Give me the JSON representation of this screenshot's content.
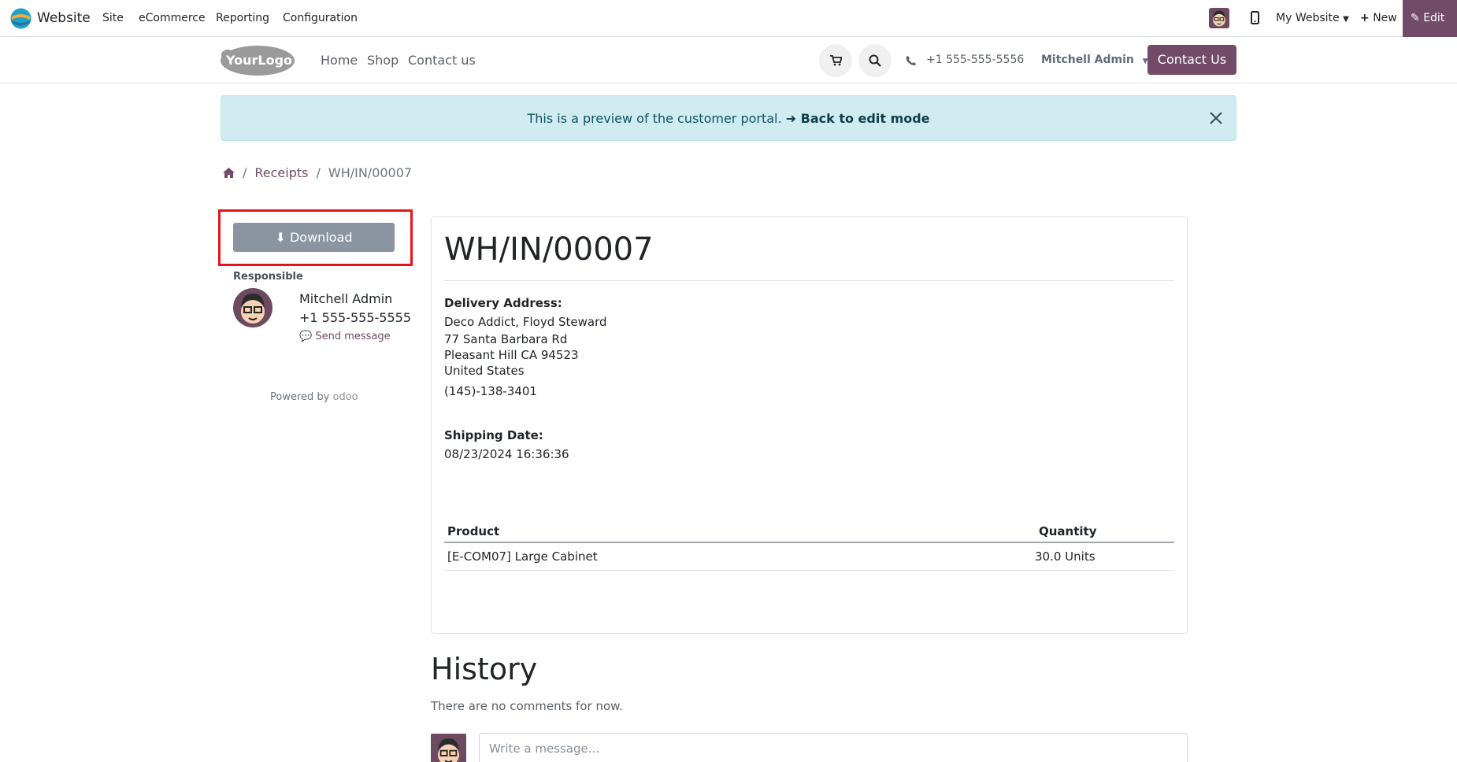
{
  "topbar": {
    "app_name": "Website",
    "menu": [
      "Site",
      "eCommerce",
      "Reporting",
      "Configuration"
    ],
    "website_switcher": "My Website",
    "new_label": "New",
    "edit_label": "Edit",
    "accent_color": "#714b67"
  },
  "header": {
    "logo_text": "YourLogo",
    "nav": [
      "Home",
      "Shop",
      "Contact us"
    ],
    "phone": "+1 555-555-5556",
    "user": "Mitchell Admin",
    "contact_button": "Contact Us"
  },
  "alert": {
    "message": "This is a preview of the customer portal.",
    "back_link": "Back to edit mode"
  },
  "breadcrumb": {
    "items": [
      "Receipts",
      "WH/IN/00007"
    ]
  },
  "sidebar": {
    "download_label": "Download",
    "responsible_label": "Responsible",
    "responsible_name": "Mitchell Admin",
    "responsible_phone": "+1 555-555-5555",
    "send_message": "Send message",
    "powered_by": "Powered by",
    "powered_brand": "odoo"
  },
  "document": {
    "title": "WH/IN/00007",
    "delivery_label": "Delivery Address:",
    "address": [
      "Deco Addict, Floyd Steward",
      "77 Santa Barbara Rd",
      "Pleasant Hill CA 94523",
      "United States"
    ],
    "address_phone": "(145)-138-3401",
    "shipping_label": "Shipping Date:",
    "shipping_date": "08/23/2024 16:36:36",
    "columns": [
      "Product",
      "Quantity"
    ],
    "rows": [
      {
        "product": "[E-COM07] Large Cabinet",
        "quantity": "30.0 Units"
      }
    ]
  },
  "history": {
    "title": "History",
    "empty_text": "There are no comments for now.",
    "placeholder": "Write a message..."
  }
}
